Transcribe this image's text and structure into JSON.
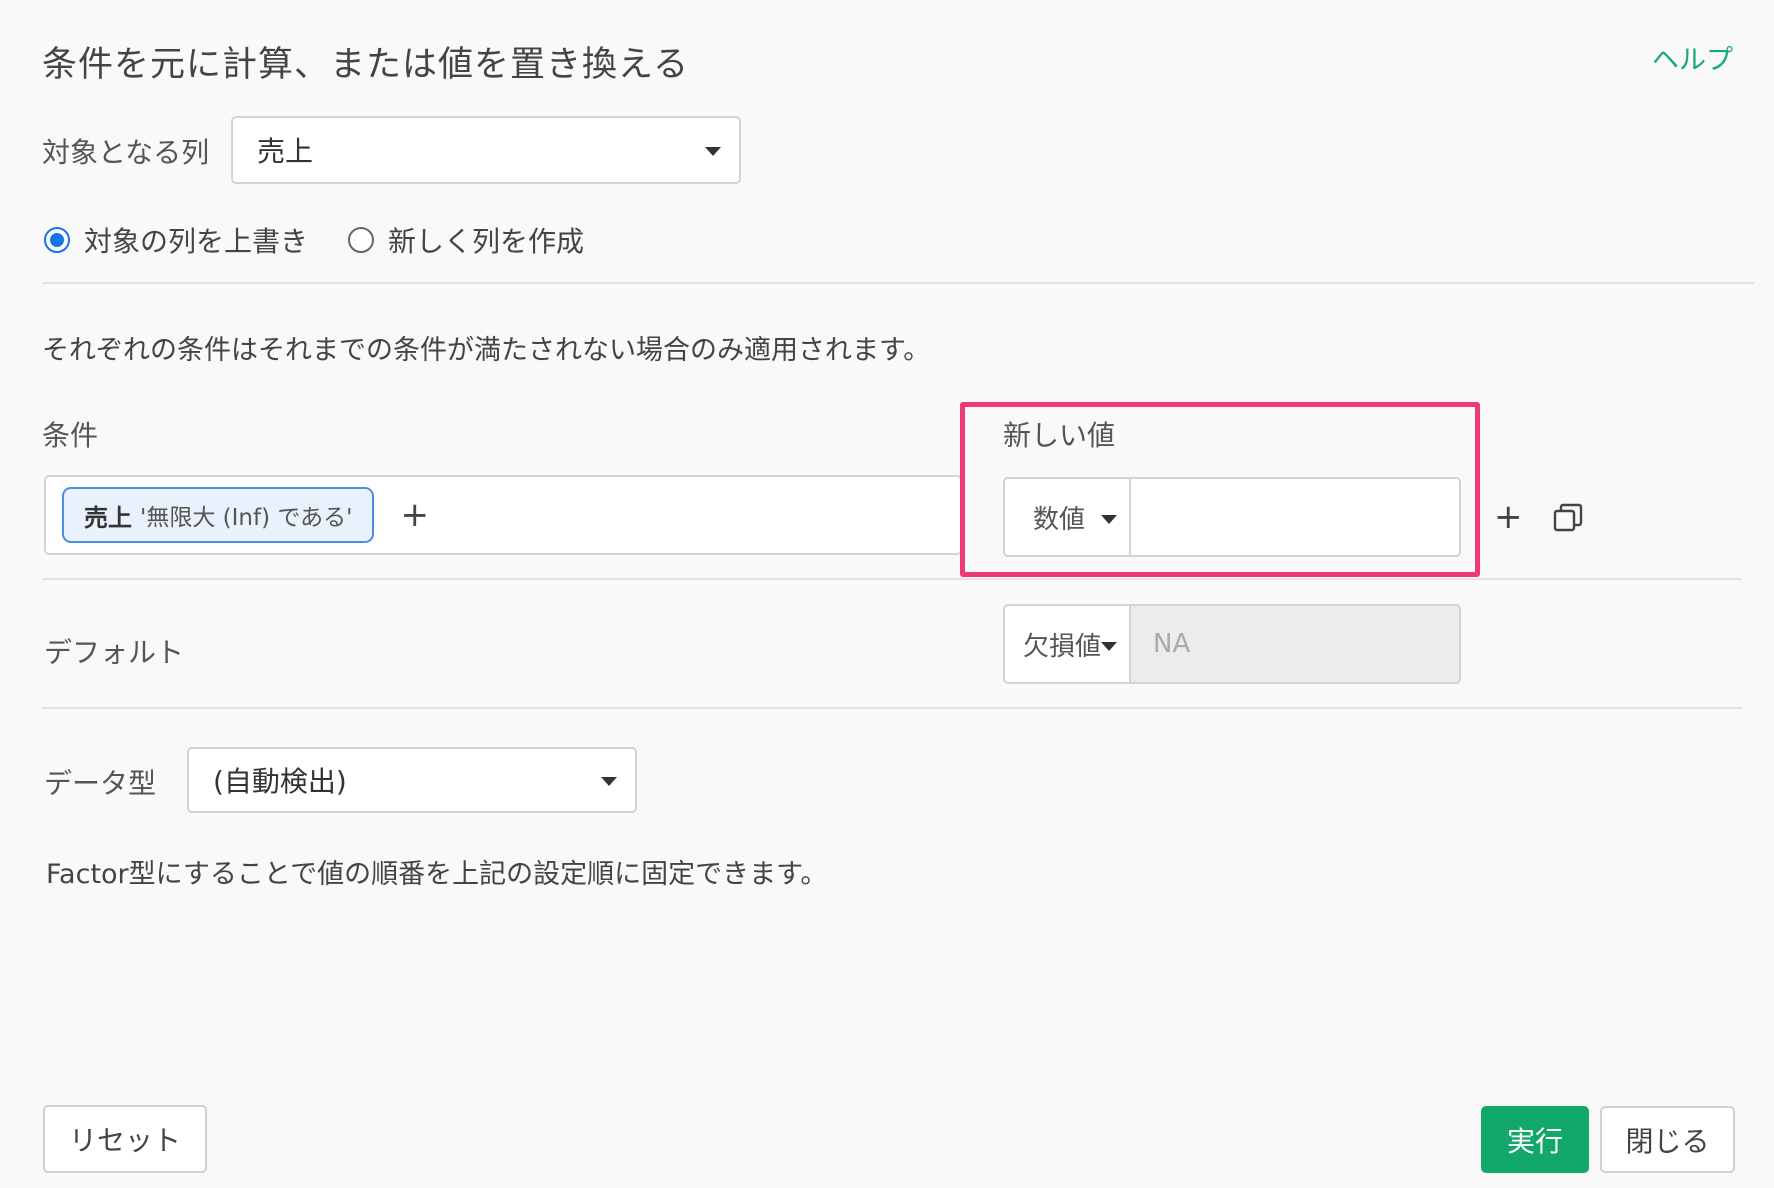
{
  "header": {
    "title": "条件を元に計算、または値を置き換える",
    "help": "ヘルプ"
  },
  "target_column": {
    "label": "対象となる列",
    "value": "売上"
  },
  "mode": {
    "overwrite": "対象の列を上書き",
    "create_new": "新しく列を作成",
    "selected": "overwrite"
  },
  "description": "それぞれの条件はそれまでの条件が満たされない場合のみ適用されます。",
  "conditions": {
    "label": "条件",
    "chip_column": "売上",
    "chip_text": "'無限大 (Inf) である'",
    "add_symbol": "+"
  },
  "new_value": {
    "label": "新しい値",
    "type": "数値",
    "value": ""
  },
  "default": {
    "label": "デフォルト",
    "type": "欠損値",
    "placeholder": "NA"
  },
  "data_type": {
    "label": "データ型",
    "value": "(自動検出)"
  },
  "factor_note": "Factor型にすることで値の順番を上記の設定順に固定できます。",
  "footer": {
    "reset": "リセット",
    "run": "実行",
    "close": "閉じる"
  },
  "colors": {
    "accent": "#13a86b",
    "highlight": "#ee3a73",
    "radio": "#1a73e8"
  }
}
